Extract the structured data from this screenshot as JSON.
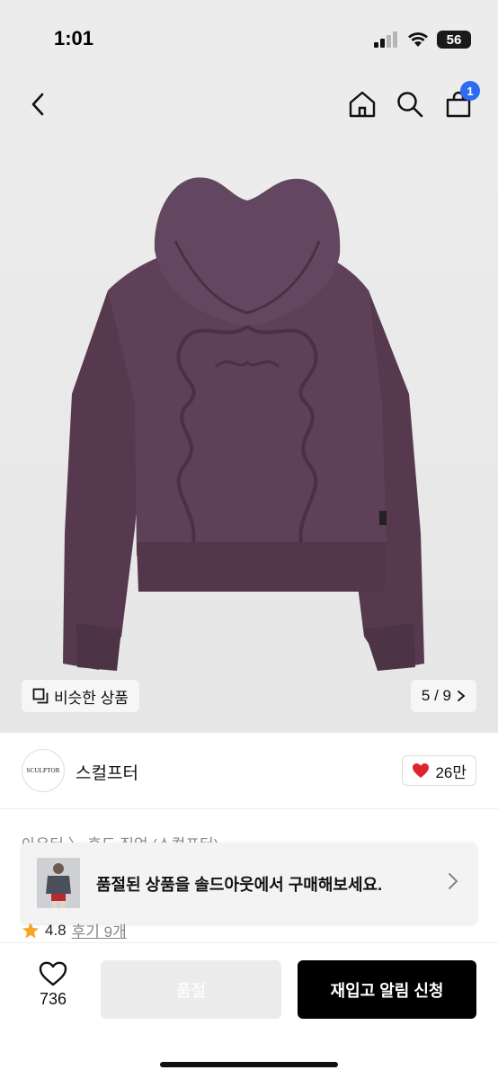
{
  "status_bar": {
    "time": "1:01",
    "battery": "56"
  },
  "nav": {
    "cart_count": "1"
  },
  "gallery": {
    "similar_label": "비슷한 상품",
    "page_indicator": "5 / 9"
  },
  "brand": {
    "logo_text": "SCULPTOR",
    "name": "스컬프터",
    "like_count": "26만"
  },
  "breadcrumb": "아우터 〉 후드 집업 (스컬프터)",
  "rating": {
    "value": "4.8",
    "reviews": "후기 9개"
  },
  "soldout_banner": {
    "text": "품절된 상품을 솔드아웃에서 구매해보세요."
  },
  "bottom_bar": {
    "wish_count": "736",
    "soldout_label": "품절",
    "restock_label": "재입고 알림 신청"
  },
  "colors": {
    "hoodie": "#5a3f55",
    "accent_badge": "#2e6bf0",
    "heart": "#e0242f",
    "star": "#f5a623"
  }
}
